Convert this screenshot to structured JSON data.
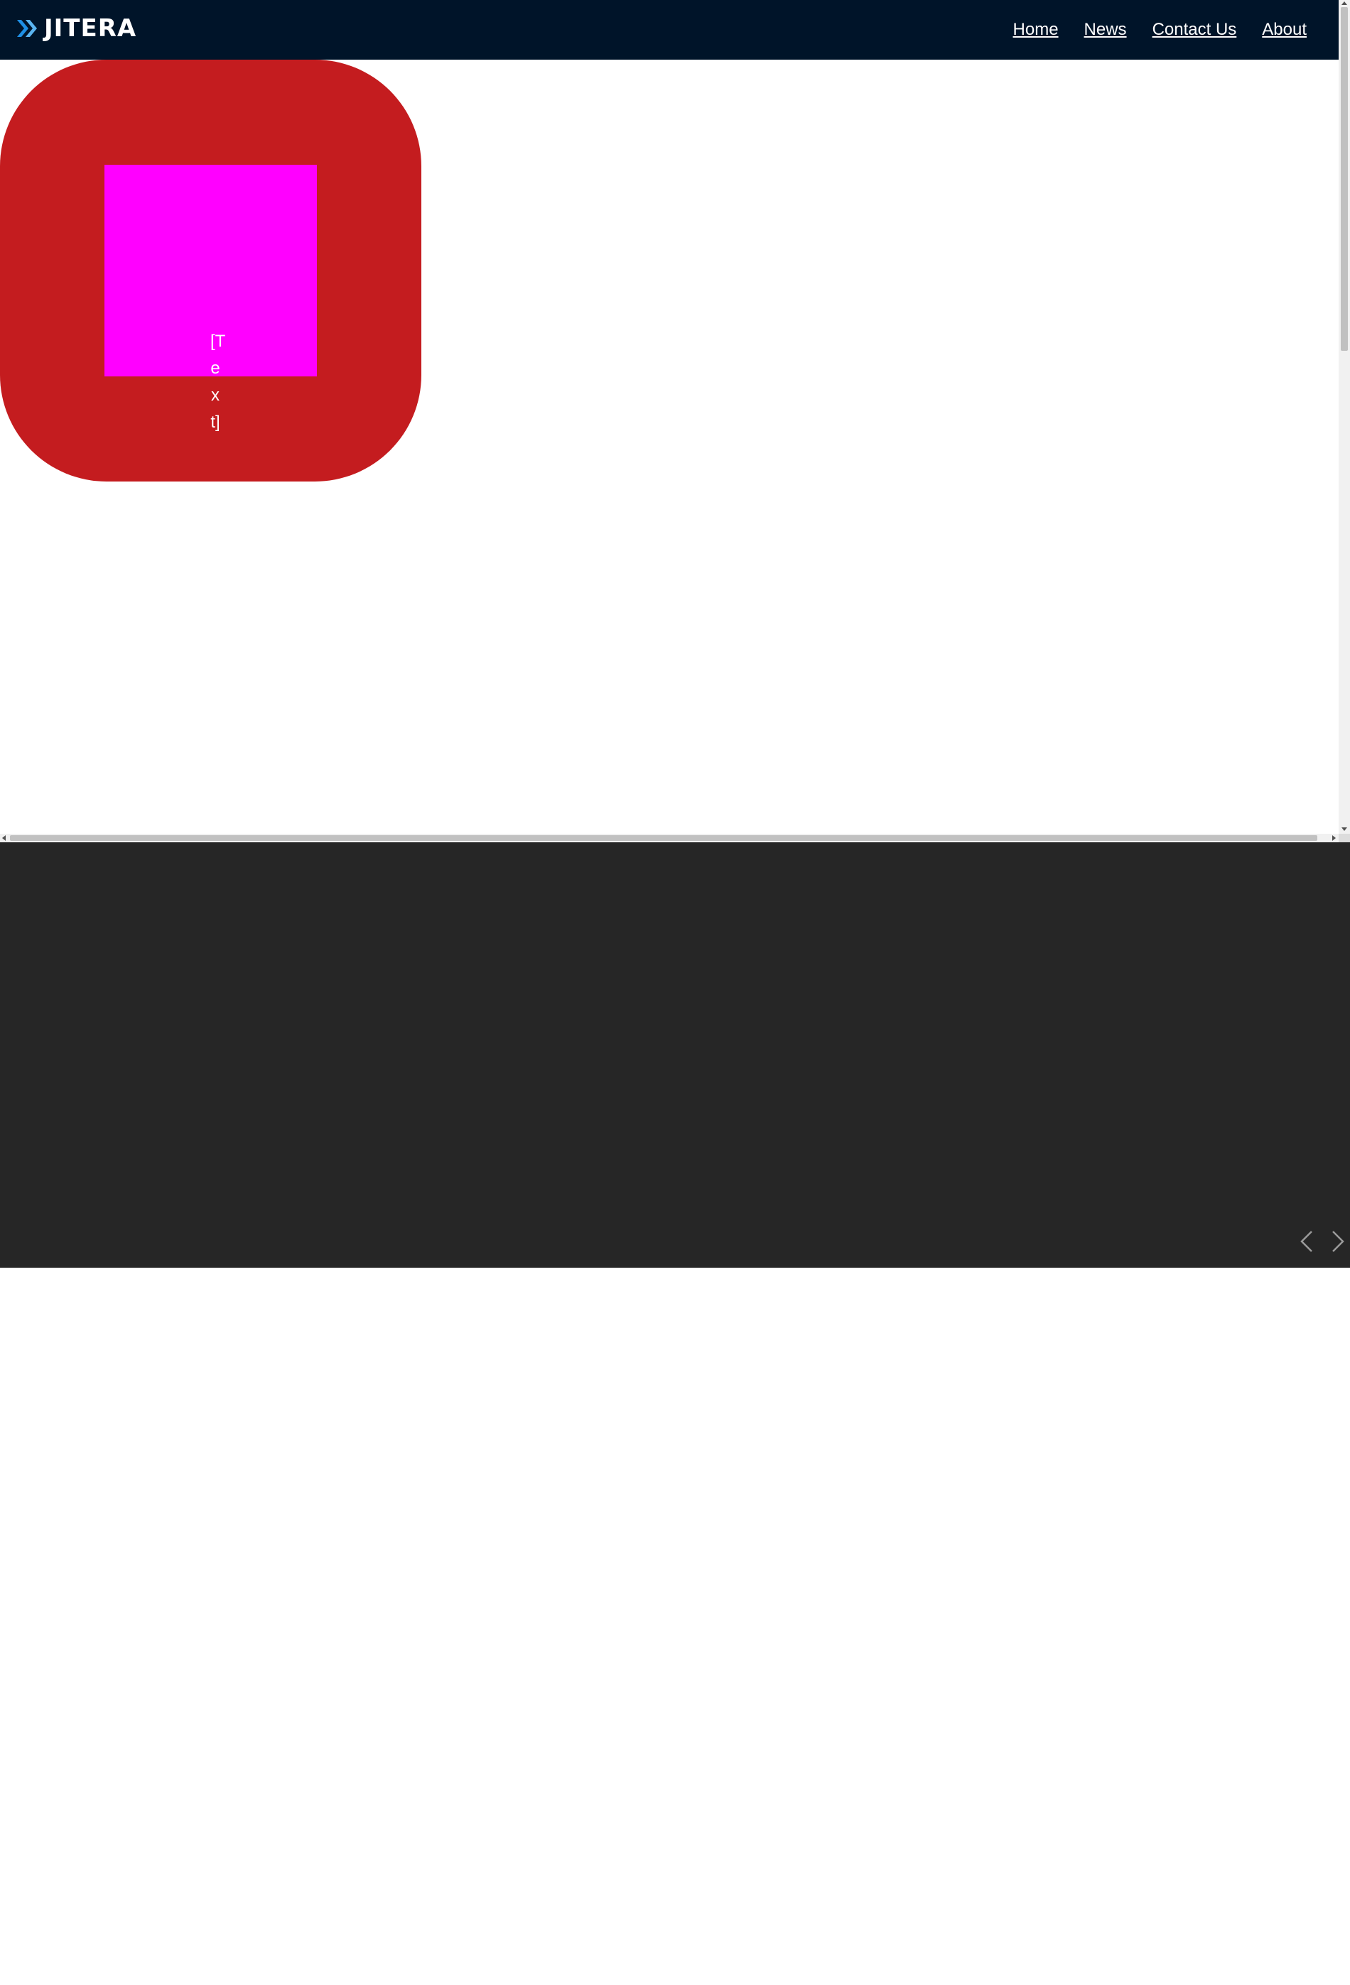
{
  "header": {
    "logo_text": "JITERA",
    "logo_icon": "double-chevron-right-icon",
    "nav_links": [
      {
        "label": "Home"
      },
      {
        "label": "News"
      },
      {
        "label": "Contact Us"
      },
      {
        "label": "About"
      }
    ]
  },
  "hero": {
    "text": "[Text]",
    "box_color": "#c41c1f",
    "inner_color": "#ff00ff"
  },
  "slider": {
    "prev_icon": "chevron-left-icon",
    "next_icon": "chevron-right-icon",
    "background": "#262626"
  },
  "colors": {
    "navbar": "#001429",
    "logo_accent": "#1e90e6"
  }
}
